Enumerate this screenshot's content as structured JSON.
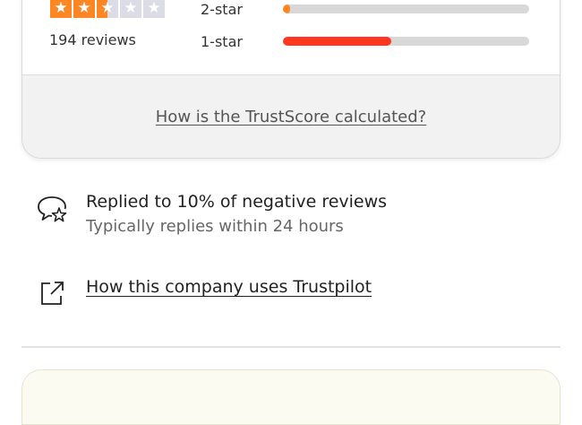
{
  "summary": {
    "stars": [
      "full",
      "full",
      "half",
      "empty",
      "empty"
    ],
    "reviews_text": "194 reviews",
    "ratings": [
      {
        "label": "2-star",
        "fraction": 0.03,
        "color": "#ff8622"
      },
      {
        "label": "1-star",
        "fraction": 0.44,
        "color": "#ff3722"
      }
    ],
    "calc_link": "How is the TrustScore calculated?"
  },
  "replies": {
    "title": "Replied to 10% of negative reviews",
    "subtitle": "Typically replies within 24 hours",
    "icon": "chat-star-icon"
  },
  "company_link": {
    "label": "How this company uses Trustpilot",
    "icon": "external-link-icon"
  }
}
